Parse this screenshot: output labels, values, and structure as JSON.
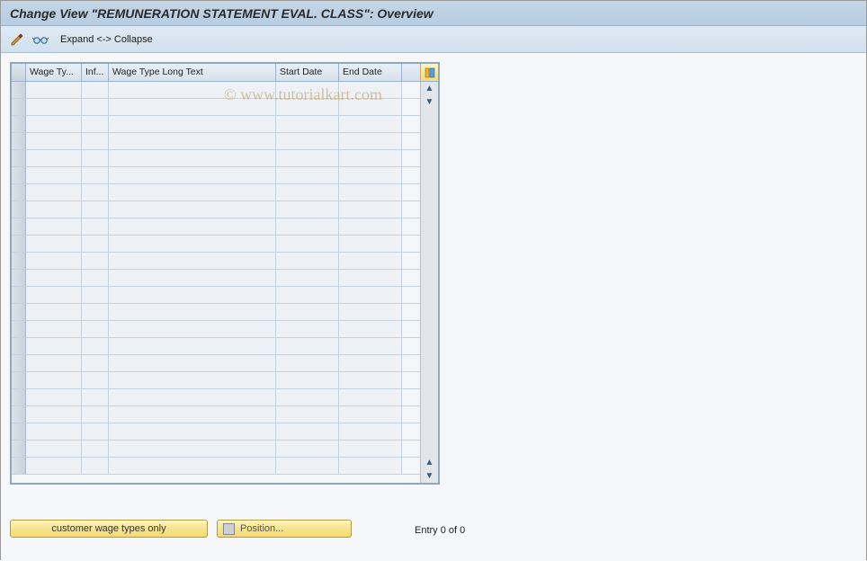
{
  "title": "Change View \"REMUNERATION STATEMENT EVAL. CLASS\": Overview",
  "toolbar": {
    "edit_icon": "pencil-icon",
    "glasses_icon": "glasses-icon",
    "expand_collapse": "Expand <-> Collapse"
  },
  "watermark": "© www.tutorialkart.com",
  "table": {
    "headers": {
      "wage_ty": "Wage Ty...",
      "inf": "Inf...",
      "long_text": "Wage Type Long Text",
      "start_date": "Start Date",
      "end_date": "End Date"
    },
    "config_icon": "table-settings-icon",
    "rows": [
      {},
      {},
      {},
      {},
      {},
      {},
      {},
      {},
      {},
      {},
      {},
      {},
      {},
      {},
      {},
      {},
      {},
      {},
      {},
      {},
      {},
      {},
      {}
    ]
  },
  "footer": {
    "customer_btn": "customer wage types only",
    "position_btn": "Position...",
    "status": "Entry 0 of 0"
  }
}
